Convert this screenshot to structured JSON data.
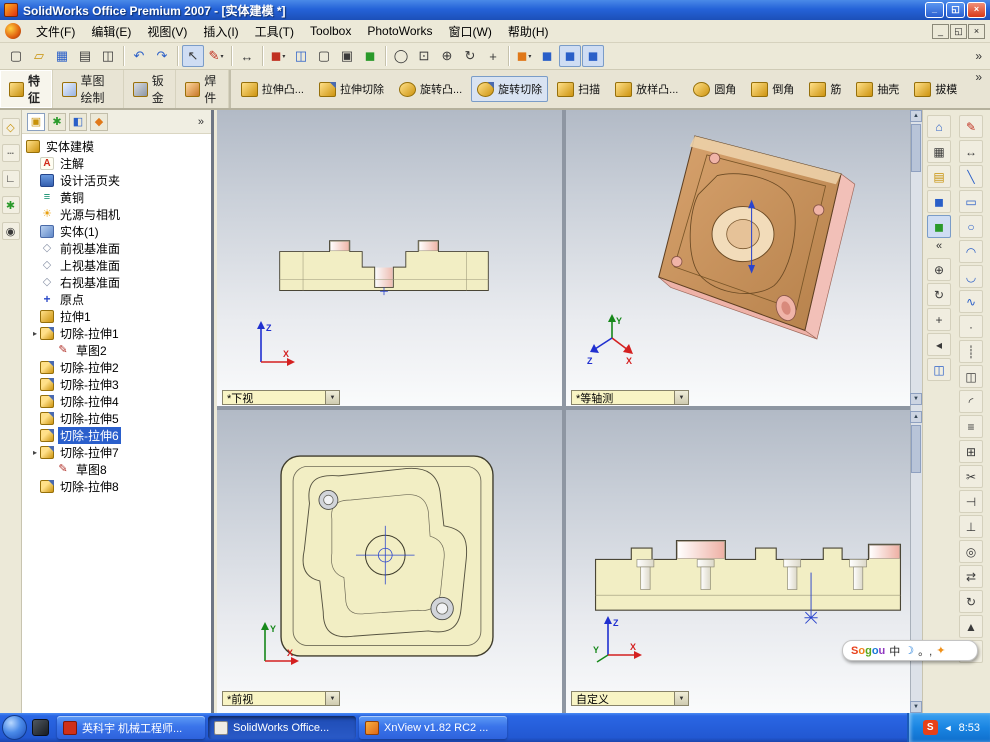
{
  "titlebar": {
    "title": "SolidWorks Office Premium 2007 - [实体建模 *]"
  },
  "window_controls": {
    "minimize": "_",
    "restore": "◱",
    "close": "×"
  },
  "child_window_controls": {
    "minimize": "_",
    "restore": "◱",
    "close": "×"
  },
  "menubar": {
    "items": [
      "文件(F)",
      "编辑(E)",
      "视图(V)",
      "插入(I)",
      "工具(T)",
      "Toolbox",
      "PhotoWorks",
      "窗口(W)",
      "帮助(H)"
    ]
  },
  "toolbar": {
    "icons": [
      {
        "name": "new",
        "glyph": "▢"
      },
      {
        "name": "open",
        "glyph": "▱"
      },
      {
        "name": "save",
        "glyph": "▦"
      },
      {
        "name": "print",
        "glyph": "▤"
      },
      {
        "name": "print-preview",
        "glyph": "◫"
      },
      {
        "name": "undo",
        "glyph": "↶"
      },
      {
        "name": "redo",
        "glyph": "↷"
      },
      {
        "name": "select",
        "glyph": "↖"
      },
      {
        "name": "sketch",
        "glyph": "✎"
      },
      {
        "name": "dimension",
        "glyph": "↔"
      },
      {
        "name": "view-orientation",
        "glyph": "◼"
      },
      {
        "name": "section-view",
        "glyph": "◫"
      },
      {
        "name": "wireframe",
        "glyph": "▢"
      },
      {
        "name": "hidden-lines",
        "glyph": "▣"
      },
      {
        "name": "shaded",
        "glyph": "◼"
      },
      {
        "name": "zoom-fit",
        "glyph": "◯"
      },
      {
        "name": "zoom-area",
        "glyph": "⊡"
      },
      {
        "name": "zoom-in-out",
        "glyph": "⊕"
      },
      {
        "name": "rotate-view",
        "glyph": "↻"
      },
      {
        "name": "pan",
        "glyph": "+"
      },
      {
        "name": "standard-views",
        "glyph": "◼"
      },
      {
        "name": "display-mode",
        "glyph": "◼"
      },
      {
        "name": "toolbox-a",
        "glyph": "◼"
      },
      {
        "name": "toolbox-b",
        "glyph": "◼"
      }
    ],
    "overflow": "»"
  },
  "command_manager": {
    "tabs": [
      {
        "label": "特征"
      },
      {
        "label": "草图绘制"
      },
      {
        "label": "钣金"
      },
      {
        "label": "焊件"
      }
    ],
    "buttons": [
      {
        "label": "拉伸凸..."
      },
      {
        "label": "拉伸切除"
      },
      {
        "label": "旋转凸..."
      },
      {
        "label": "旋转切除"
      },
      {
        "label": "扫描"
      },
      {
        "label": "放样凸..."
      },
      {
        "label": "圆角"
      },
      {
        "label": "倒角"
      },
      {
        "label": "筋"
      },
      {
        "label": "抽壳"
      },
      {
        "label": "拔模"
      }
    ],
    "overflow": "»"
  },
  "left_toolbar": {
    "icons": [
      {
        "name": "reference-plane",
        "glyph": "◇"
      },
      {
        "name": "reference-axis",
        "glyph": "┄"
      },
      {
        "name": "coordinate-system",
        "glyph": "∟"
      },
      {
        "name": "reference-point",
        "glyph": "✱"
      },
      {
        "name": "mate-reference",
        "glyph": "◉"
      }
    ]
  },
  "feature_manager": {
    "tabs": [
      {
        "glyph": "▣"
      },
      {
        "glyph": "✱"
      },
      {
        "glyph": "◧"
      },
      {
        "glyph": "◆"
      }
    ],
    "overflow": "»"
  },
  "feature_tree": {
    "items": [
      {
        "label": "实体建模"
      },
      {
        "label": "注解",
        "glyph": "A"
      },
      {
        "label": "设计活页夹"
      },
      {
        "label": "黄铜",
        "glyph": "≡"
      },
      {
        "label": "光源与相机",
        "glyph": "☀"
      },
      {
        "label": "实体(1)"
      },
      {
        "label": "前视基准面",
        "glyph": "◇"
      },
      {
        "label": "上视基准面",
        "glyph": "◇"
      },
      {
        "label": "右视基准面",
        "glyph": "◇"
      },
      {
        "label": "原点",
        "glyph": "+"
      },
      {
        "label": "拉伸1"
      },
      {
        "label": "切除-拉伸1"
      },
      {
        "label": "草图2",
        "glyph": "✎"
      },
      {
        "label": "切除-拉伸2"
      },
      {
        "label": "切除-拉伸3"
      },
      {
        "label": "切除-拉伸4"
      },
      {
        "label": "切除-拉伸5"
      },
      {
        "label": "切除-拉伸6"
      },
      {
        "label": "切除-拉伸7"
      },
      {
        "label": "草图8",
        "glyph": "✎"
      },
      {
        "label": "切除-拉伸8"
      }
    ]
  },
  "viewports": {
    "top_left": {
      "label": "*下视",
      "triad_up": "Z",
      "triad_right": "X"
    },
    "top_right": {
      "label": "*等轴测",
      "triad_up": "Y",
      "triad_right": "X",
      "triad_left": "Z"
    },
    "bottom_left": {
      "label": "*前视",
      "triad_up": "Y",
      "triad_right": "X"
    },
    "bottom_right": {
      "label": "自定义",
      "triad_up": "Z",
      "triad_right": "X",
      "triad_left": "Y"
    }
  },
  "right_toolbar": {
    "col_a": [
      {
        "name": "view-home",
        "glyph": "⌂"
      },
      {
        "name": "four-view",
        "glyph": "▦"
      },
      {
        "name": "drawing-sheet",
        "glyph": "▤"
      },
      {
        "name": "view-cube",
        "glyph": "◼"
      },
      {
        "name": "shaded-view",
        "glyph": "◼"
      },
      {
        "name": "zoom",
        "glyph": "⊕"
      },
      {
        "name": "rotate",
        "glyph": "↻"
      },
      {
        "name": "pan",
        "glyph": "+"
      },
      {
        "name": "previous-view",
        "glyph": "◂"
      },
      {
        "name": "section",
        "glyph": "◫"
      }
    ],
    "col_b": [
      {
        "name": "sketch",
        "glyph": "✎"
      },
      {
        "name": "smart-dimension",
        "glyph": "↔"
      },
      {
        "name": "line",
        "glyph": "╲"
      },
      {
        "name": "rectangle",
        "glyph": "▭"
      },
      {
        "name": "circle",
        "glyph": "○"
      },
      {
        "name": "arc",
        "glyph": "◠"
      },
      {
        "name": "tangent-arc",
        "glyph": "◡"
      },
      {
        "name": "spline",
        "glyph": "∿"
      },
      {
        "name": "point",
        "glyph": "·"
      },
      {
        "name": "centerline",
        "glyph": "┊"
      },
      {
        "name": "mirror",
        "glyph": "◫"
      },
      {
        "name": "fillet",
        "glyph": "◜"
      },
      {
        "name": "offset",
        "glyph": "≡"
      },
      {
        "name": "convert-entities",
        "glyph": "⊞"
      },
      {
        "name": "trim",
        "glyph": "✂"
      },
      {
        "name": "extend",
        "glyph": "⊣"
      },
      {
        "name": "relations",
        "glyph": "⊥"
      },
      {
        "name": "display-relations",
        "glyph": "◎"
      },
      {
        "name": "move-entities",
        "glyph": "⇄"
      },
      {
        "name": "rotate-entities",
        "glyph": "↻"
      },
      {
        "name": "scale-entities",
        "glyph": "▲"
      },
      {
        "name": "pattern",
        "glyph": "∷"
      }
    ]
  },
  "ui": {
    "combo_arrow": "▼",
    "up": "▲",
    "down": "▼",
    "collapse": "«",
    "expander": "▸",
    "caret": "▾"
  },
  "sogou": {
    "letters": [
      "S",
      "o",
      "g",
      "o",
      "u"
    ],
    "mode": "中",
    "items": [
      {
        "glyph": "☽"
      },
      {
        "glyph": "。,"
      },
      {
        "glyph": "✦"
      }
    ]
  },
  "taskbar": {
    "buttons": [
      {
        "label": "英科宇 机械工程师..."
      },
      {
        "label": "SolidWorks Office..."
      },
      {
        "label": "XnView v1.82 RC2 ..."
      }
    ],
    "tray": {
      "sogou": "S",
      "speaker": "◄",
      "time": "8:53"
    }
  },
  "colors": {
    "part_beige": "#f2eec4",
    "part_bronze": "#c08850",
    "part_pink": "#f0b4a8",
    "selection_blue": "#2a5fcc"
  }
}
